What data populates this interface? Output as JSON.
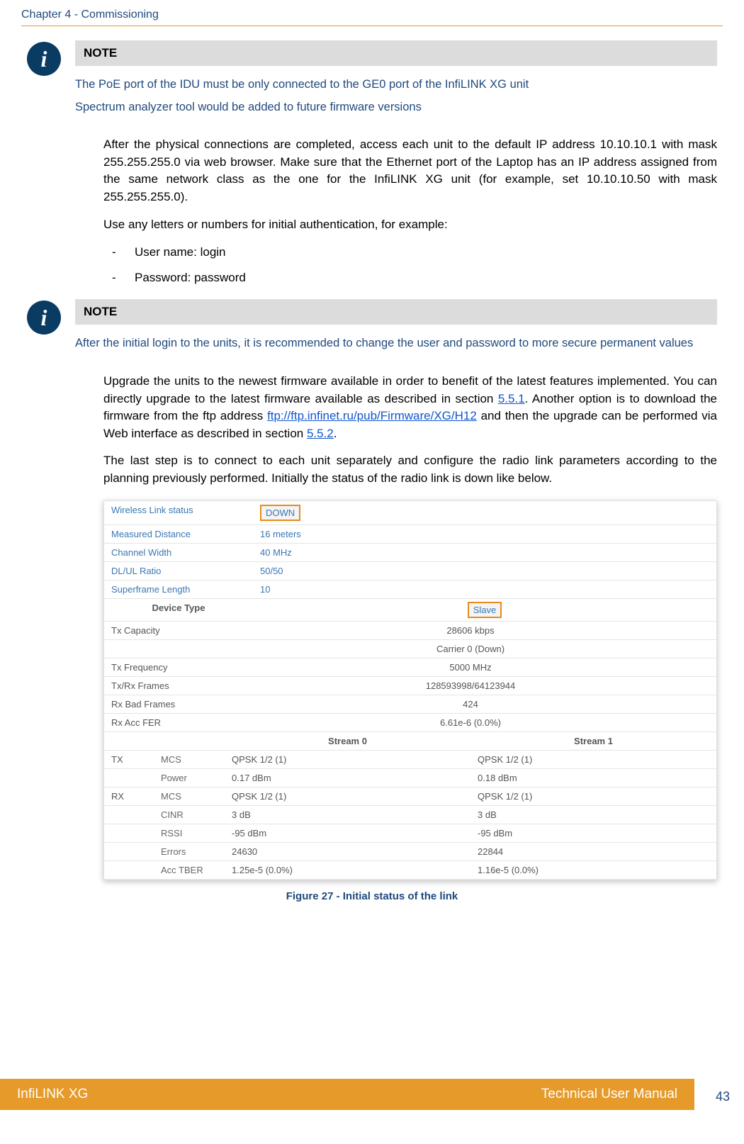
{
  "header": {
    "chapter": "Chapter 4 - Commissioning"
  },
  "note1": {
    "title": "NOTE",
    "line1": "The PoE port of the IDU must be only connected to the GE0 port of the InfiLINK XG unit",
    "line2": "Spectrum analyzer tool would be added to future firmware versions"
  },
  "para1": "After the physical connections are completed, access each unit to the default IP address 10.10.10.1 with mask 255.255.255.0 via web browser. Make sure that the Ethernet port of the Laptop has an IP address assigned from the same network class as the one for the InfiLINK XG unit (for example, set 10.10.10.50 with mask 255.255.255.0).",
  "para2": "Use any letters or numbers for initial authentication, for example:",
  "list": {
    "item1": "User name: login",
    "item2": "Password: password"
  },
  "note2": {
    "title": "NOTE",
    "line1": "After the initial login to the units, it is recommended to change the user and password to more secure permanent values"
  },
  "para3a": "Upgrade the units to the newest firmware available in order to benefit of the latest features implemented. You can directly upgrade to the latest firmware available as described in section ",
  "para3link1": "5.5.1",
  "para3b": ". Another option is to download the firmware from the ftp address ",
  "para3link2": "ftp://ftp.infinet.ru/pub/Firmware/XG/H12",
  "para3c": " and then the upgrade can be performed via Web interface as described in section ",
  "para3link3": "5.5.2",
  "para3d": ".",
  "para4": "The last step is to connect to each unit separately and configure the radio link parameters according to the planning previously performed. Initially the status of the radio link is down like below.",
  "linkstatus": {
    "rows": [
      {
        "label": "Wireless Link status",
        "val": "DOWN",
        "highlight": true,
        "blue": true
      },
      {
        "label": "Measured Distance",
        "val": "16 meters",
        "blue": true
      },
      {
        "label": "Channel Width",
        "val": "40 MHz",
        "blue": true
      },
      {
        "label": "DL/UL Ratio",
        "val": "50/50",
        "blue": true
      },
      {
        "label": "Superframe Length",
        "val": "10",
        "blue": true
      }
    ],
    "deviceTypeLabel": "Device Type",
    "deviceTypeVal": "Slave",
    "wide": [
      {
        "label": "Tx Capacity",
        "val": "28606 kbps"
      },
      {
        "label": "",
        "val": "Carrier 0 (Down)"
      },
      {
        "label": "Tx Frequency",
        "val": "5000 MHz"
      },
      {
        "label": "Tx/Rx Frames",
        "val": "128593998/64123944"
      },
      {
        "label": "Rx Bad Frames",
        "val": "424"
      },
      {
        "label": "Rx Acc FER",
        "val": "6.61e-6 (0.0%)"
      }
    ],
    "streamHeader": {
      "s0": "Stream 0",
      "s1": "Stream 1"
    },
    "stream": [
      {
        "grp": "TX",
        "label": "MCS",
        "s0": "QPSK 1/2 (1)",
        "s1": "QPSK 1/2 (1)"
      },
      {
        "grp": "",
        "label": "Power",
        "s0": "0.17 dBm",
        "s1": "0.18 dBm"
      },
      {
        "grp": "RX",
        "label": "MCS",
        "s0": "QPSK 1/2 (1)",
        "s1": "QPSK 1/2 (1)"
      },
      {
        "grp": "",
        "label": "CINR",
        "s0": "3 dB",
        "s1": "3 dB"
      },
      {
        "grp": "",
        "label": "RSSI",
        "s0": "-95 dBm",
        "s1": "-95 dBm"
      },
      {
        "grp": "",
        "label": "Errors",
        "s0": "24630",
        "s1": "22844"
      },
      {
        "grp": "",
        "label": "Acc TBER",
        "s0": "1.25e-5 (0.0%)",
        "s1": "1.16e-5 (0.0%)"
      }
    ]
  },
  "figureCaption": "Figure 27 - Initial status of the link",
  "footer": {
    "left": "InfiLINK XG",
    "right": "Technical User Manual",
    "page": "43"
  }
}
